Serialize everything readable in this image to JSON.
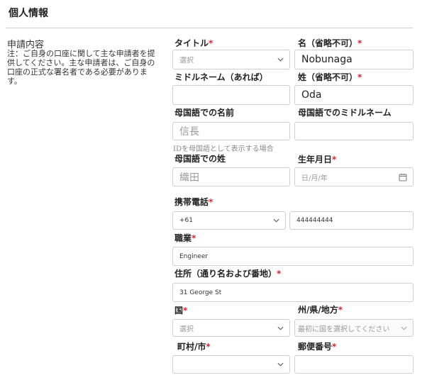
{
  "section_title": "個人情報",
  "side": {
    "label": "申請内容",
    "note": "注：ご自身の口座に関して主な申請者を提供してください。主な申請者は、ご自身の口座の正式な署名者である必要があります。"
  },
  "fields": {
    "title": {
      "label": "タイトル",
      "placeholder": "選択"
    },
    "first_name": {
      "label": "名（省略不可）",
      "value": "Nobunaga"
    },
    "middle_name": {
      "label": "ミドルネーム（あれば）",
      "value": ""
    },
    "last_name": {
      "label": "姓（省略不可）",
      "value": "Oda"
    },
    "native_first_name": {
      "label": "母国語での名前",
      "value": "信長",
      "hint": "IDを母国語として表示する場合"
    },
    "native_middle_name": {
      "label": "母国語でのミドルネーム",
      "value": ""
    },
    "native_last_name": {
      "label": "母国語での姓",
      "value": "織田"
    },
    "birth_date": {
      "label": "生年月日",
      "placeholder": "日/月/年"
    },
    "mobile": {
      "label": "携帯電話",
      "country_code": "+61",
      "number": "444444444"
    },
    "occupation": {
      "label": "職業",
      "value": "Engineer"
    },
    "address": {
      "label": "住所（通り名および番地）",
      "value": "31 George St"
    },
    "country": {
      "label": "国",
      "placeholder": "選択"
    },
    "state": {
      "label": "州/県/地方",
      "placeholder": "最初に国を選択してください"
    },
    "city": {
      "label": "町村/市",
      "value": ""
    },
    "postal_code": {
      "label": "郵便番号",
      "value": ""
    }
  },
  "required_mark": "*",
  "icons": [
    "chevron-down-icon",
    "calendar-icon"
  ]
}
